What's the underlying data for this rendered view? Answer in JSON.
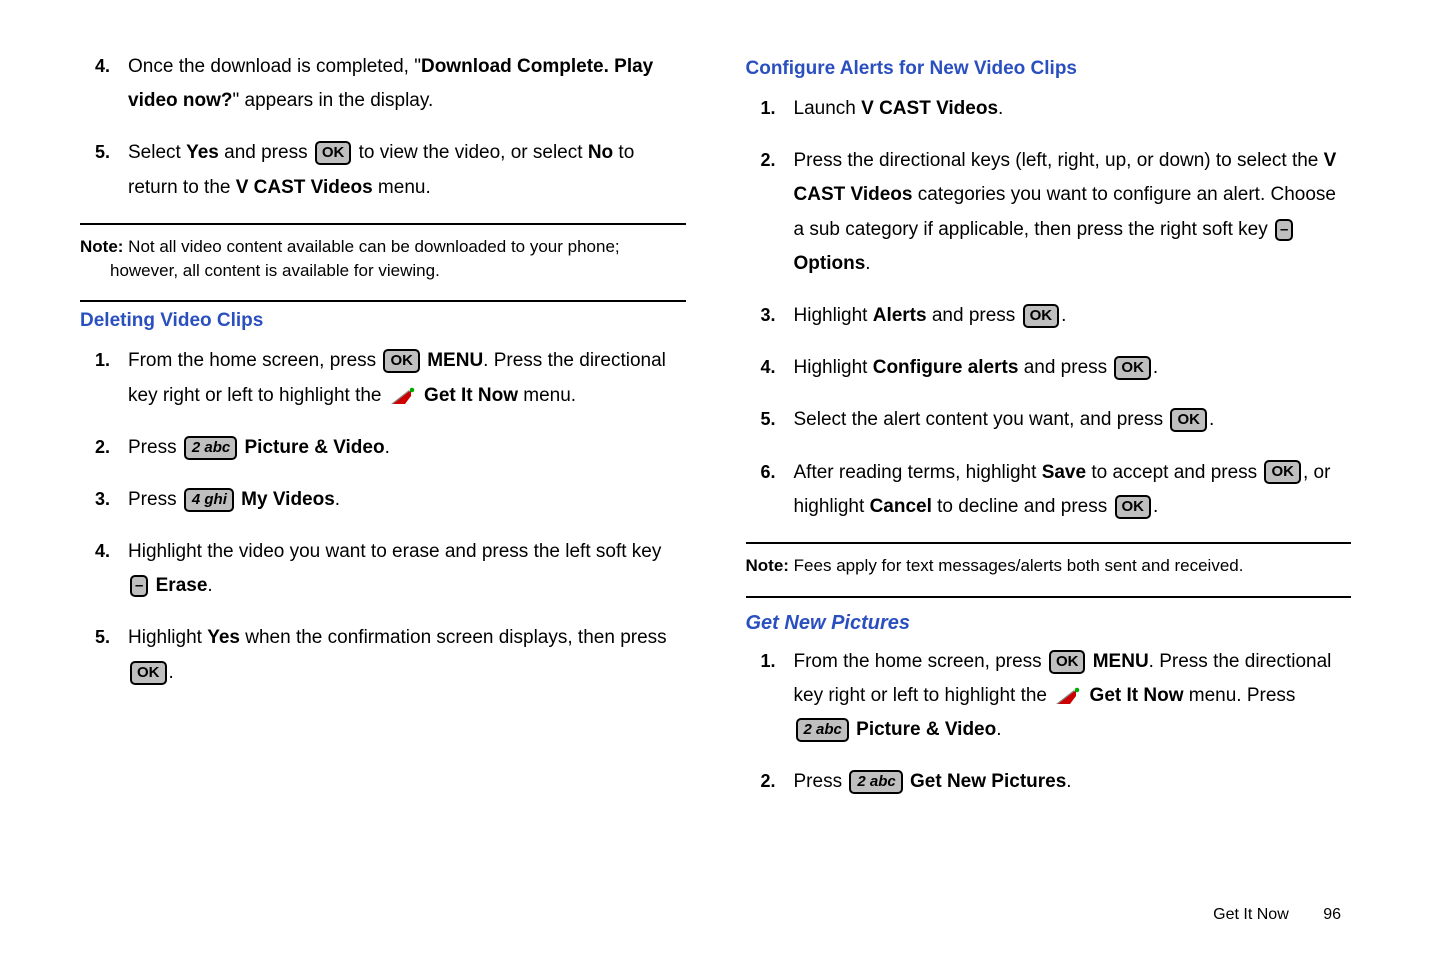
{
  "left": {
    "step4": {
      "pre": "Once the download is completed, \"",
      "bold1": "Download Complete. Play video now?",
      "post": "\" appears in the display."
    },
    "step5": {
      "p1": "Select ",
      "yes": "Yes",
      "p2": " and press ",
      "ok": "OK",
      "p3": " to view the video, or select ",
      "no": "No",
      "p4": " to return to the ",
      "vcast": "V CAST Videos",
      "p5": " menu."
    },
    "note1_label": "Note:",
    "note1_a": " Not all video content available can be downloaded to your phone;",
    "note1_b": "however, all content is available for viewing.",
    "deleting_heading": "Deleting Video Clips",
    "d1": {
      "a": "From the home screen, press ",
      "ok": "OK",
      "menu": " MENU",
      "b": ". Press the directional key right or left to highlight the ",
      "get_it_now": "Get It Now",
      "c": " menu."
    },
    "d2": {
      "a": "Press ",
      "key": "2 abc",
      "b": "Picture & Video",
      "c": "."
    },
    "d3": {
      "a": "Press ",
      "key": "4 ghi",
      "b": "My Videos",
      "c": "."
    },
    "d4": {
      "a": "Highlight the video you want to erase and press the left soft key ",
      "dash": "–",
      "erase": "Erase",
      "c": "."
    },
    "d5": {
      "a": "Highlight ",
      "yes": "Yes",
      "b": " when the confirmation screen displays, then press ",
      "ok": "OK",
      "c": "."
    }
  },
  "right": {
    "configure_heading": "Configure Alerts for New Video Clips",
    "c1": {
      "a": "Launch ",
      "b": "V CAST Videos",
      "c": "."
    },
    "c2": {
      "a": "Press the directional keys (left, right, up, or down) to select the ",
      "b": "V CAST Videos",
      "c": " categories you want to configure an alert. Choose a sub category if applicable, then press the right soft key ",
      "dash": "–",
      "opt": "Options",
      "d": "."
    },
    "c3": {
      "a": "Highlight ",
      "b": "Alerts",
      "c": " and press ",
      "ok": "OK",
      "d": "."
    },
    "c4": {
      "a": "Highlight ",
      "b": "Configure alerts",
      "c": " and press ",
      "ok": "OK",
      "d": "."
    },
    "c5": {
      "a": "Select the alert content you want, and press ",
      "ok": "OK",
      "b": "."
    },
    "c6": {
      "a": "After reading terms, highlight ",
      "save": "Save",
      "b": " to accept and press ",
      "ok1": "OK",
      "c": ", or highlight ",
      "cancel": "Cancel",
      "d": " to decline and press ",
      "ok2": "OK",
      "e": "."
    },
    "note2_label": "Note:",
    "note2": " Fees apply for text messages/alerts both sent and received.",
    "get_new_heading": "Get New Pictures",
    "g1": {
      "a": "From the home screen, press ",
      "ok": "OK",
      "menu": " MENU",
      "b": ". Press the directional key right or left to highlight the ",
      "gin": "Get It Now",
      "c": " menu. Press ",
      "key": "2 abc",
      "pv": "Picture & Video",
      "d": "."
    },
    "g2": {
      "a": "Press ",
      "key": "2 abc",
      "b": "Get New Pictures",
      "c": "."
    }
  },
  "footer": {
    "section": "Get It Now",
    "page": "96"
  },
  "nums": {
    "n1": "1.",
    "n2": "2.",
    "n3": "3.",
    "n4": "4.",
    "n5": "5.",
    "n6": "6."
  }
}
